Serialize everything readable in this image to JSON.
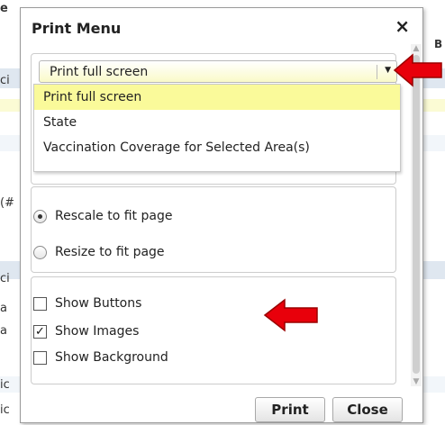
{
  "background": {
    "fragments": [
      "e",
      "ci",
      "(#",
      "ci",
      "a",
      "a",
      "ic",
      "ic",
      "B"
    ]
  },
  "dialog": {
    "title": "Print Menu",
    "close_label": "×",
    "select": {
      "value": "Print full screen",
      "options": [
        "Print full screen",
        "State",
        "Vaccination Coverage for Selected Area(s)"
      ]
    },
    "scale_options": [
      {
        "label": "Rescale to fit page",
        "checked": true
      },
      {
        "label": "Resize to fit page",
        "checked": false
      }
    ],
    "show_options": [
      {
        "label": "Show Buttons",
        "checked": false
      },
      {
        "label": "Show Images",
        "checked": true
      },
      {
        "label": "Show Background",
        "checked": false
      }
    ],
    "buttons": {
      "print": "Print",
      "close": "Close"
    }
  },
  "annotations": {
    "arrow_color": "#e8000b"
  }
}
